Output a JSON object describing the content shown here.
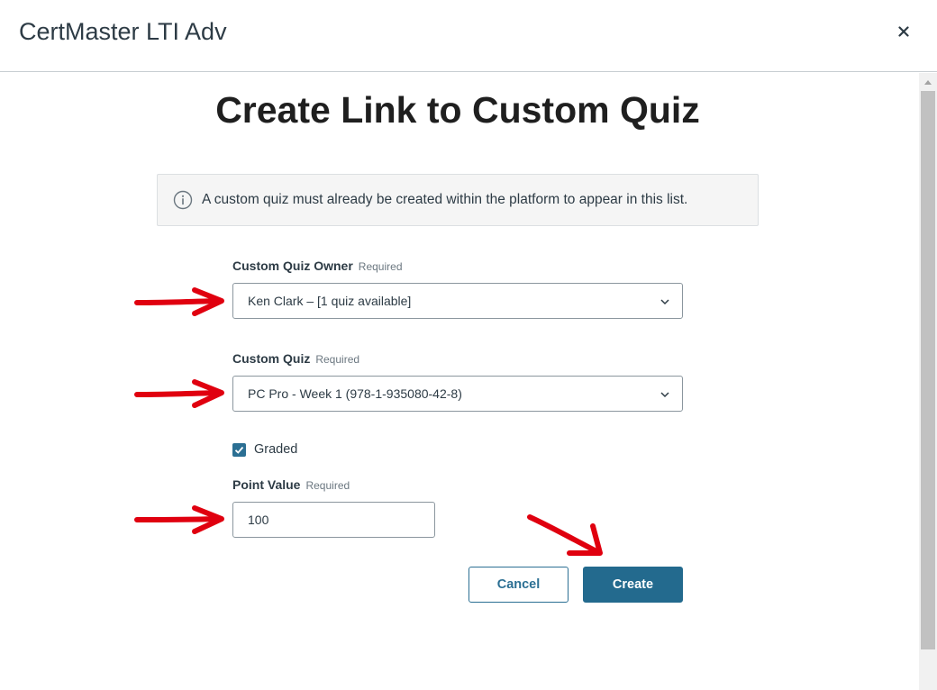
{
  "app": {
    "title": "CertMaster LTI Adv",
    "close_label": "×"
  },
  "page": {
    "heading": "Create Link to Custom Quiz",
    "info_message": "A custom quiz must already be created within the platform to appear in this list."
  },
  "form": {
    "owner": {
      "label": "Custom Quiz Owner",
      "required": "Required",
      "value": "Ken Clark – [1 quiz available]"
    },
    "quiz": {
      "label": "Custom Quiz",
      "required": "Required",
      "value": "PC Pro - Week 1 (978-1-935080-42-8)"
    },
    "graded": {
      "label": "Graded",
      "checked": true
    },
    "points": {
      "label": "Point Value",
      "required": "Required",
      "value": "100"
    }
  },
  "actions": {
    "cancel_label": "Cancel",
    "create_label": "Create"
  },
  "colors": {
    "accent": "#236a8e",
    "annotation_arrow": "#e0000f"
  },
  "icons": {
    "close": "close-icon",
    "info": "info-icon",
    "chevron": "chevron-down-icon",
    "check": "checkmark-icon"
  }
}
